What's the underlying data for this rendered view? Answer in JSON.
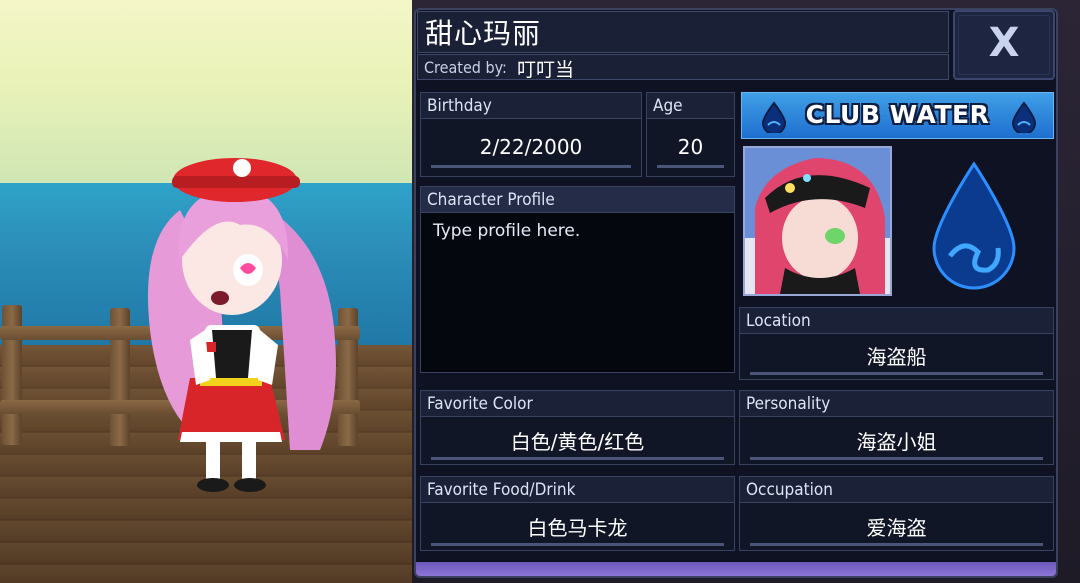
{
  "character": {
    "name": "甜心玛丽",
    "created_by_label": "Created by:",
    "creator": "叮叮当"
  },
  "close_button": {
    "label": "X"
  },
  "fields": {
    "birthday": {
      "label": "Birthday",
      "value": "2/22/2000"
    },
    "age": {
      "label": "Age",
      "value": "20"
    },
    "profile": {
      "label": "Character Profile",
      "placeholder": "Type profile here."
    },
    "location": {
      "label": "Location",
      "value": "海盗船"
    },
    "favorite_color": {
      "label": "Favorite Color",
      "value": "白色/黄色/红色"
    },
    "personality": {
      "label": "Personality",
      "value": "海盗小姐"
    },
    "favorite_food": {
      "label": "Favorite Food/Drink",
      "value": "白色马卡龙"
    },
    "occupation": {
      "label": "Occupation",
      "value": "爱海盗"
    }
  },
  "club": {
    "name": "CLUB WATER",
    "icon": "water-drop-icon"
  },
  "colors": {
    "panel_bg": "#0e1222",
    "field_header": "#1b2238",
    "club_blue": "#2f86dc",
    "accent_purple": "#8d77d8"
  }
}
